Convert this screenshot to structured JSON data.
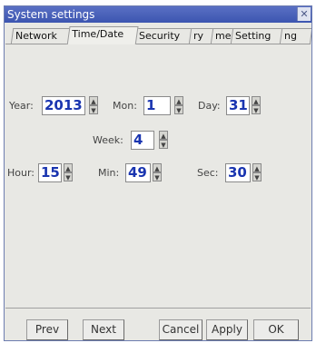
{
  "window": {
    "title": "System settings",
    "close_glyph": "✕"
  },
  "tabs": [
    "Network",
    "Time/Date",
    "Security",
    "ry",
    "me",
    "Setting",
    "ng"
  ],
  "fields": {
    "year": {
      "label": "Year:",
      "value": "2013"
    },
    "mon": {
      "label": "Mon:",
      "value": "1"
    },
    "day": {
      "label": "Day:",
      "value": "31"
    },
    "week": {
      "label": "Week:",
      "value": "4"
    },
    "hour": {
      "label": "Hour:",
      "value": "15"
    },
    "min": {
      "label": "Min:",
      "value": "49"
    },
    "sec": {
      "label": "Sec:",
      "value": "30"
    }
  },
  "buttons": {
    "prev": "Prev",
    "next": "Next",
    "cancel": "Cancel",
    "apply": "Apply",
    "ok": "OK"
  },
  "spin_glyphs": {
    "up": "▲",
    "down": "▼"
  },
  "colors": {
    "title_bar": "#3c55b0",
    "field_text": "#1a35b0",
    "window_bg": "#e8e8e4"
  }
}
